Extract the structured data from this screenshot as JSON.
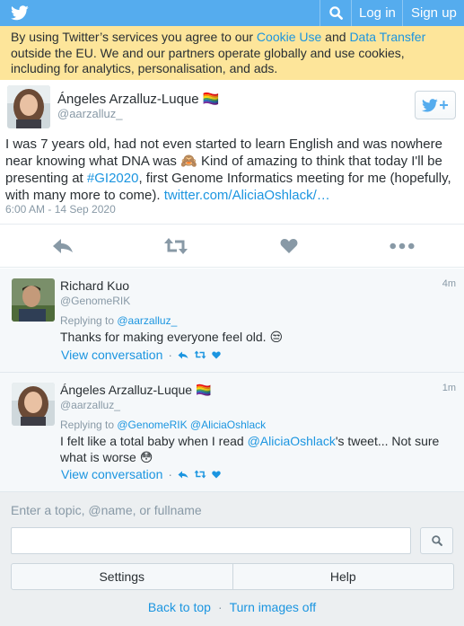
{
  "topbar": {
    "search_icon": "search-icon",
    "login_label": "Log in",
    "signup_label": "Sign up",
    "brand_color": "#55acee"
  },
  "cookie_banner": {
    "text_before": "By using Twitter’s services you agree to our ",
    "cookie_link": "Cookie Use",
    "text_middle": " and ",
    "transfer_link": "Data Transfer",
    "text_after": " outside the EU. We and our partners operate globally and use cookies, including for analytics, personalisation, and ads.",
    "background": "#fde59a"
  },
  "main_tweet": {
    "name": "Ángeles Arzalluz-Luque 🏳️‍🌈",
    "handle": "@aarzalluz_",
    "text_before": "I was 7 years old, had not even started to learn English and was nowhere near knowing what DNA was 🙈 Kind of amazing to think that today I'll be presenting at ",
    "hashtag": "#GI2020",
    "text_after": ", first Genome Informatics meeting for me (hopefully, with many more to come). ",
    "link": "twitter.com/AliciaOshlack/…",
    "timestamp": "6:00 AM - 14 Sep 2020",
    "actions": [
      "reply-icon",
      "retweet-icon",
      "like-icon",
      "more-icon"
    ]
  },
  "replies": [
    {
      "name": "Richard Kuo",
      "handle": "@GenomeRIK",
      "time": "4m",
      "replying_prefix": "Replying to ",
      "replying_to": "@aarzalluz_",
      "text": "Thanks for making everyone feel old. 😒",
      "view_conversation": "View conversation",
      "separator": "·"
    },
    {
      "name": "Ángeles Arzalluz-Luque 🏳️‍🌈",
      "handle": "@aarzalluz_",
      "time": "1m",
      "replying_prefix": "Replying to ",
      "replying_to": "@GenomeRIK @AliciaOshlack",
      "text_mention": "@AliciaOshlack",
      "text_before": "I felt like a total baby when I read ",
      "text_after": "'s tweet... Not sure what is worse 😳",
      "view_conversation": "View conversation",
      "separator": "·"
    }
  ],
  "footer": {
    "search_label": "Enter a topic, @name, or fullname",
    "search_value": "",
    "settings_label": "Settings",
    "help_label": "Help",
    "back_to_top": "Back to top",
    "separator": "·",
    "turn_images_off": "Turn images off"
  }
}
